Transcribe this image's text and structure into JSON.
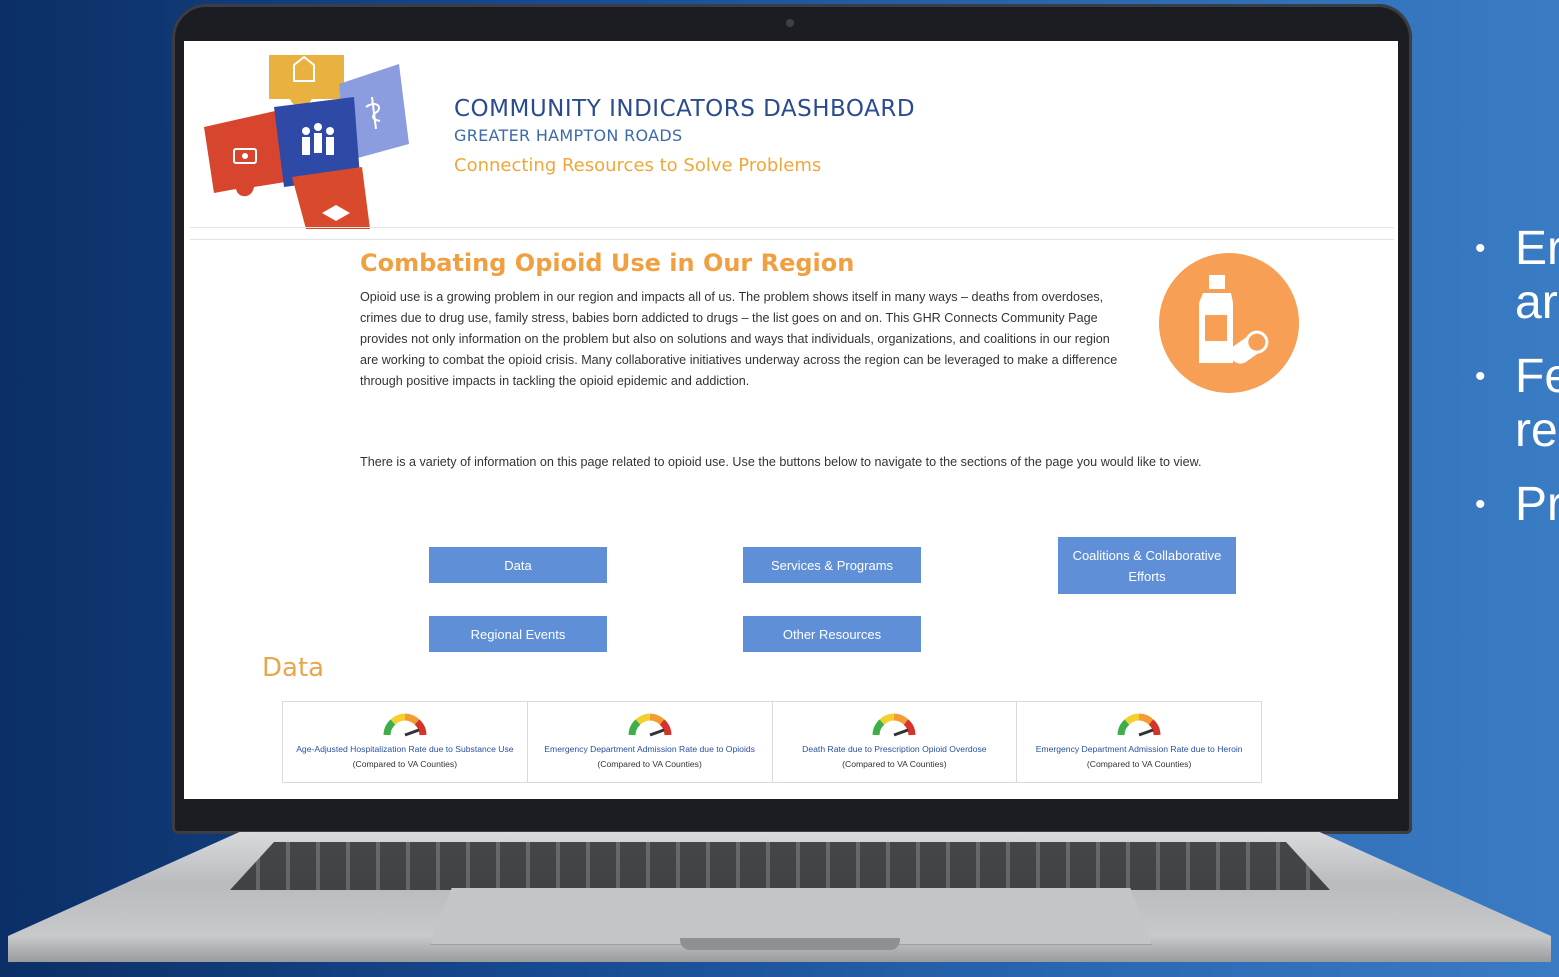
{
  "slide": {
    "bullets": [
      "Er",
      "Fe",
      "Pr"
    ],
    "bullet_continuations": [
      "ar",
      "re",
      ""
    ]
  },
  "header": {
    "title": "COMMUNITY INDICATORS DASHBOARD",
    "subtitle": "GREATER HAMPTON ROADS",
    "tagline": "Connecting Resources to Solve Problems"
  },
  "main": {
    "section_title": "Combating Opioid Use in Our Region",
    "intro": "Opioid use is a growing problem in our region and impacts all of us. The problem shows itself in many ways – deaths from overdoses, crimes due to drug use, family stress, babies born addicted to drugs – the list goes on and on. This GHR Connects Community Page provides not only information on the problem but also on solutions and ways that individuals, organizations, and coalitions in our region are working to combat the opioid crisis. Many collaborative initiatives underway across the region can be leveraged to make a difference through positive impacts in tackling the opioid epidemic and addiction.",
    "variety_text": "There is a variety of information on this page related to opioid use. Use the buttons below to navigate to the sections of the page you would like to view.",
    "buttons": {
      "data": "Data",
      "services": "Services & Programs",
      "coalitions": "Coalitions & Collaborative Efforts",
      "events": "Regional Events",
      "resources": "Other Resources"
    },
    "data_heading": "Data",
    "indicators": [
      {
        "label": "Age-Adjusted Hospitalization Rate due to Substance Use",
        "comparison": "(Compared to VA Counties)"
      },
      {
        "label": "Emergency Department Admission Rate due to Opioids",
        "comparison": "(Compared to VA Counties)"
      },
      {
        "label": "Death Rate due to Prescription Opioid Overdose",
        "comparison": "(Compared to VA Counties)"
      },
      {
        "label": "Emergency Department Admission Rate due to Heroin",
        "comparison": "(Compared to VA Counties)"
      }
    ]
  },
  "colors": {
    "button": "#5f8fd6",
    "accent_orange": "#f0a040",
    "title_blue": "#2b4b8f",
    "link_blue": "#2a4f9e"
  },
  "icons": [
    "puzzle-logo",
    "opioid-bottle-pills-icon",
    "gauge-icon"
  ]
}
